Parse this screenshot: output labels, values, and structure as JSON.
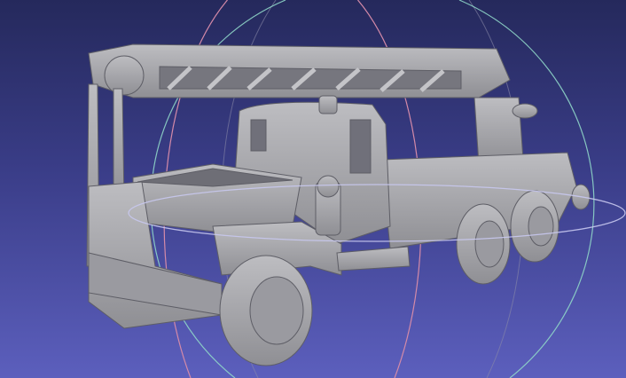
{
  "viewer": {
    "background_top": "#25295c",
    "background_bottom": "#5c5fbd",
    "mesh_color": "#a9a9ad",
    "trackball_colors": {
      "x_ring": "#d48aa8",
      "y_ring": "#8fd6c8",
      "z_ring": "#c8c8ee",
      "back_ring": "#8a8aa8"
    }
  }
}
